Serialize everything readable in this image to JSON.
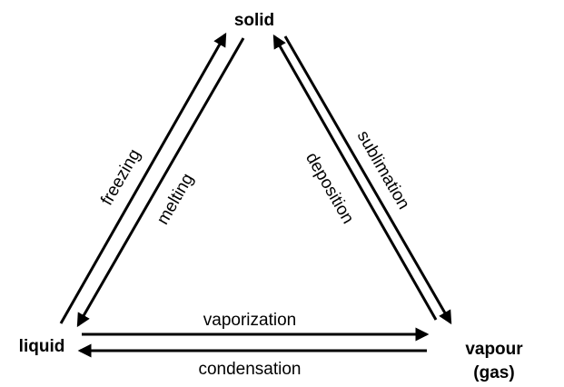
{
  "nodes": {
    "solid": "solid",
    "liquid": "liquid",
    "vapour_line1": "vapour",
    "vapour_line2": "(gas)"
  },
  "transitions": {
    "freezing": "freezing",
    "melting": "melting",
    "deposition": "deposition",
    "sublimation": "sublimation",
    "vaporization": "vaporization",
    "condensation": "condensation"
  },
  "colors": {
    "stroke": "#000000",
    "text": "#000000",
    "background": "#ffffff"
  }
}
